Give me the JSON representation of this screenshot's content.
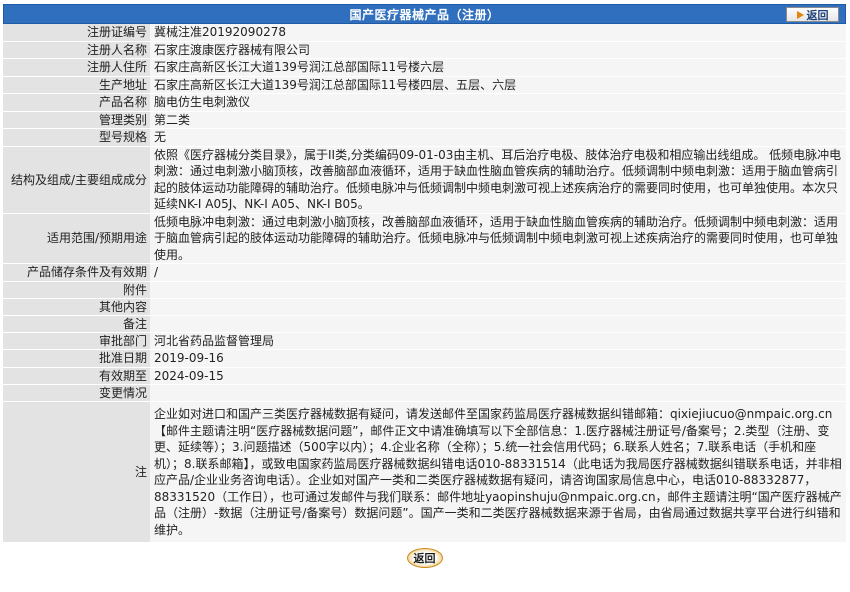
{
  "header": {
    "title": "国产医疗器械产品（注册）",
    "back_label": "返回"
  },
  "rows": [
    {
      "label": "注册证编号",
      "value": "冀械注准20192090278"
    },
    {
      "label": "注册人名称",
      "value": "石家庄渡康医疗器械有限公司"
    },
    {
      "label": "注册人住所",
      "value": "石家庄高新区长江大道139号润江总部国际11号楼六层"
    },
    {
      "label": "生产地址",
      "value": "石家庄高新区长江大道139号润江总部国际11号楼四层、五层、六层"
    },
    {
      "label": "产品名称",
      "value": "脑电仿生电刺激仪"
    },
    {
      "label": "管理类别",
      "value": "第二类"
    },
    {
      "label": "型号规格",
      "value": "无"
    },
    {
      "label": "结构及组成/主要组成成分",
      "value": "依照《医疗器械分类目录》，属于II类,分类编码09-01-03由主机、耳后治疗电极、肢体治疗电极和相应输出线组成。 低频电脉冲电刺激：通过电刺激小脑顶核，改善脑部血液循环，适用于缺血性脑血管疾病的辅助治疗。低频调制中频电刺激：适用于脑血管病引起的肢体运动功能障碍的辅助治疗。低频电脉冲与低频调制中频电刺激可视上述疾病治疗的需要同时使用，也可单独使用。本次只延续NK-I A05J、NK-I A05、NK-I B05。"
    },
    {
      "label": "适用范围/预期用途",
      "value": "低频电脉冲电刺激：通过电刺激小脑顶核，改善脑部血液循环，适用于缺血性脑血管疾病的辅助治疗。低频调制中频电刺激：适用于脑血管病引起的肢体运动功能障碍的辅助治疗。低频电脉冲与低频调制中频电刺激可视上述疾病治疗的需要同时使用，也可单独使用。"
    },
    {
      "label": "产品储存条件及有效期",
      "value": "/"
    },
    {
      "label": "附件",
      "value": ""
    },
    {
      "label": "其他内容",
      "value": ""
    },
    {
      "label": "备注",
      "value": ""
    },
    {
      "label": "审批部门",
      "value": "河北省药品监督管理局"
    },
    {
      "label": "批准日期",
      "value": "2019-09-16"
    },
    {
      "label": "有效期至",
      "value": "2024-09-15"
    },
    {
      "label": "变更情况",
      "value": ""
    }
  ],
  "note": {
    "label": "注",
    "text": "企业如对进口和国产三类医疗器械数据有疑问，请发送邮件至国家药监局医疗器械数据纠错邮箱：qixiejiucuo@nmpaic.org.cn【邮件主题请注明“医疗器械数据问题”，邮件正文中请准确填写以下全部信息：1.医疗器械注册证号/备案号；2.类型（注册、变更、延续等）；3.问题描述（500字以内）；4.企业名称（全称）；5.统一社会信用代码；6.联系人姓名；7.联系电话（手机和座机）；8.联系邮箱】，或致电国家药监局医疗器械数据纠错电话010-88331514（此电话为我局医疗器械数据纠错联系电话，并非相应产品/企业业务咨询电话）。企业如对国产一类和二类医疗器械数据有疑问，请咨询国家局信息中心，电话010-88332877，88331520（工作日），也可通过发邮件与我们联系：邮件地址yaopinshuju@nmpaic.org.cn，邮件主题请注明“国产医疗器械产品（注册）-数据（注册证号/备案号）数据问题”。国产一类和二类医疗器械数据来源于省局，由省局通过数据共享平台进行纠错和维护。"
  },
  "footer": {
    "back_label": "返回"
  }
}
